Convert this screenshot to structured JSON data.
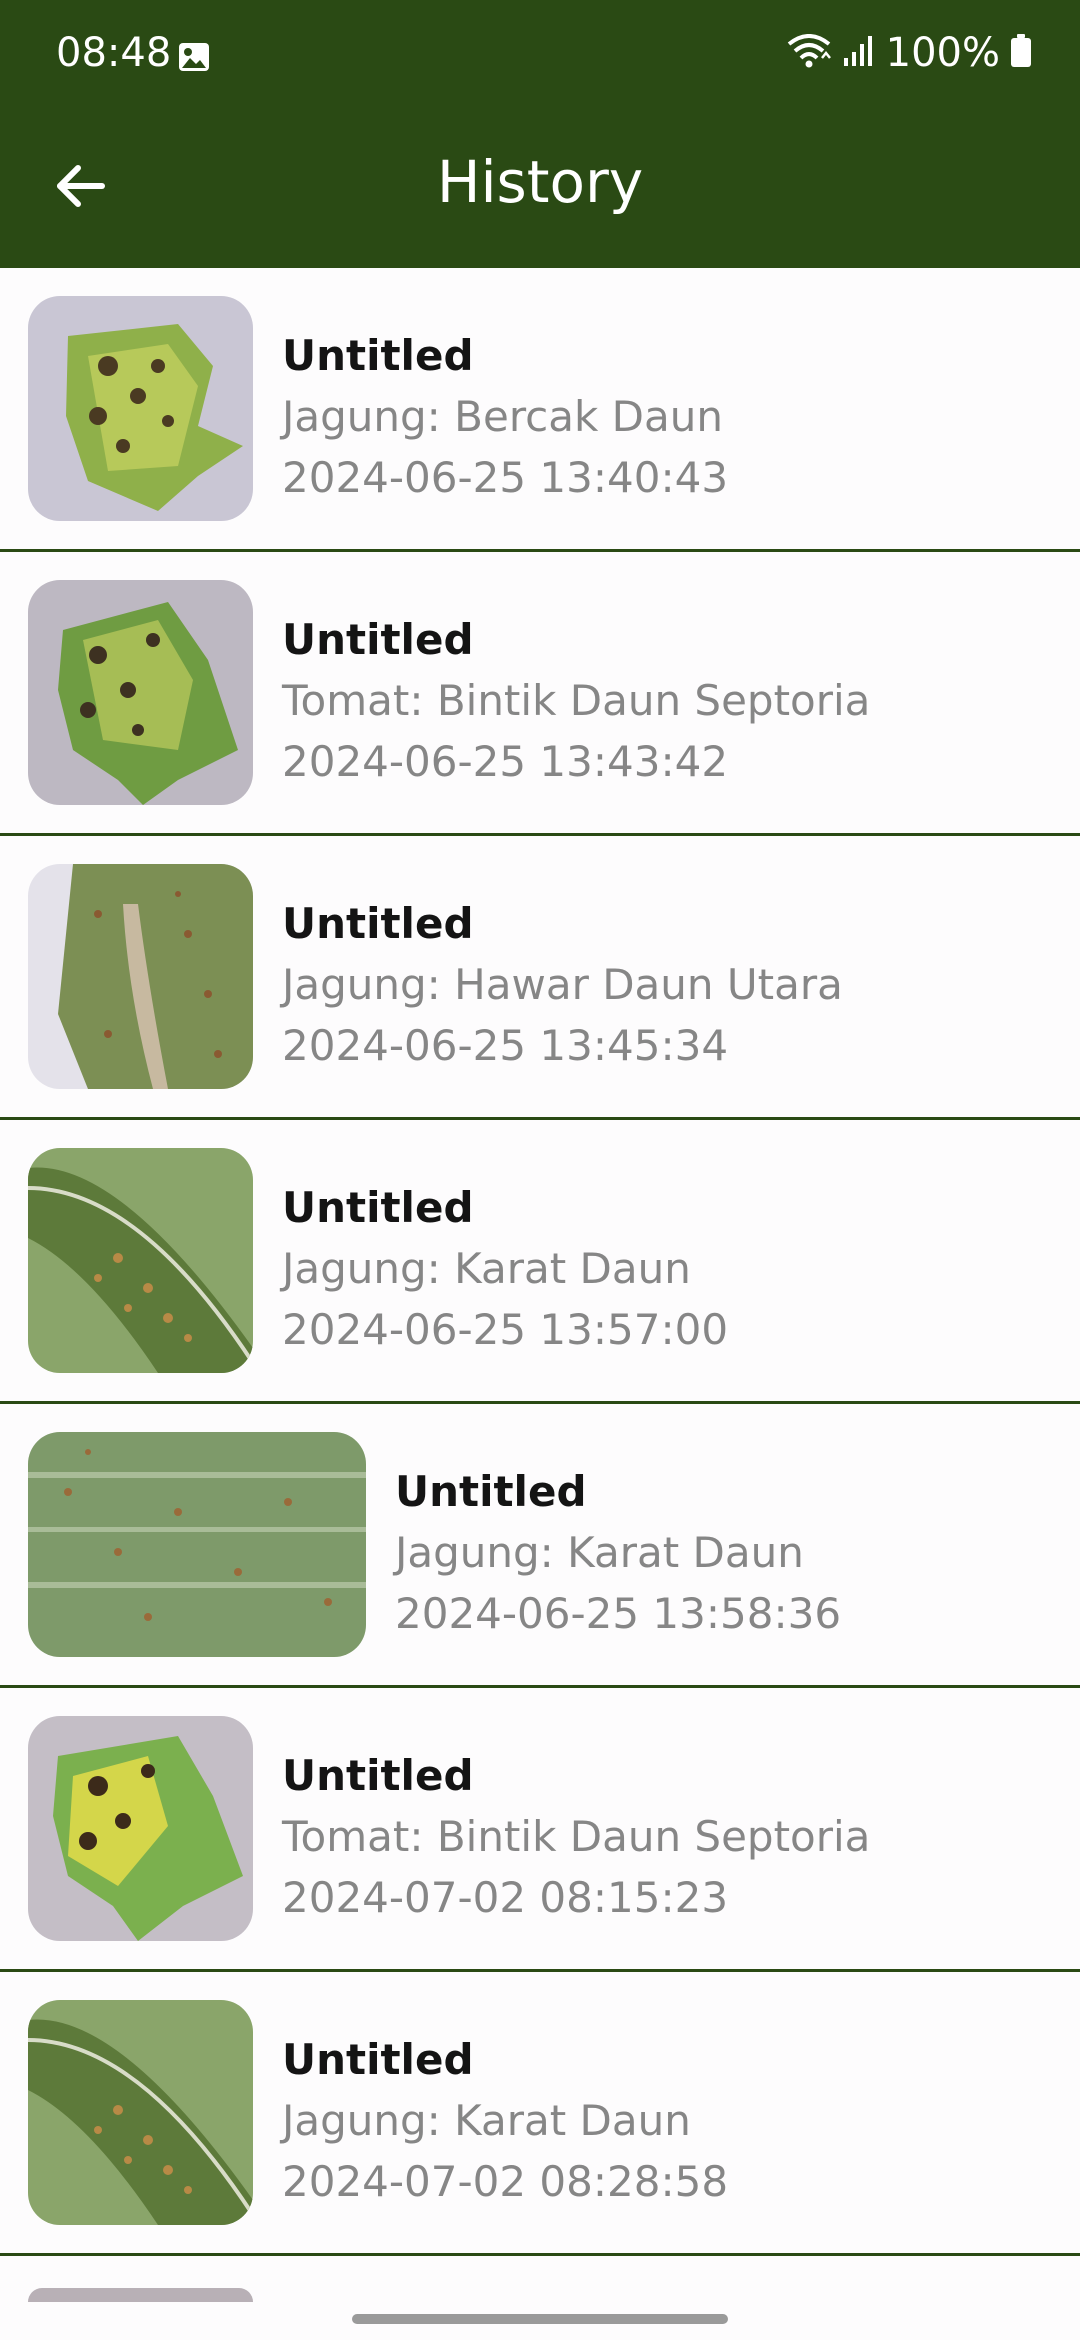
{
  "status_bar": {
    "time": "08:48",
    "battery": "100%"
  },
  "app_bar": {
    "title": "History"
  },
  "history": [
    {
      "title": "Untitled",
      "label": "Jagung: Bercak Daun",
      "datetime": "2024-06-25 13:40:43"
    },
    {
      "title": "Untitled",
      "label": "Tomat: Bintik Daun Septoria",
      "datetime": "2024-06-25 13:43:42"
    },
    {
      "title": "Untitled",
      "label": "Jagung: Hawar Daun Utara",
      "datetime": "2024-06-25 13:45:34"
    },
    {
      "title": "Untitled",
      "label": "Jagung: Karat Daun",
      "datetime": "2024-06-25 13:57:00"
    },
    {
      "title": "Untitled",
      "label": "Jagung: Karat Daun",
      "datetime": "2024-06-25 13:58:36"
    },
    {
      "title": "Untitled",
      "label": "Tomat: Bintik Daun Septoria",
      "datetime": "2024-07-02 08:15:23"
    },
    {
      "title": "Untitled",
      "label": "Jagung: Karat Daun",
      "datetime": "2024-07-02 08:28:58"
    }
  ],
  "colors": {
    "app_bar": "#2a4a14",
    "divider": "#2a4a14",
    "title_text": "#141414",
    "secondary_text": "#868686"
  }
}
